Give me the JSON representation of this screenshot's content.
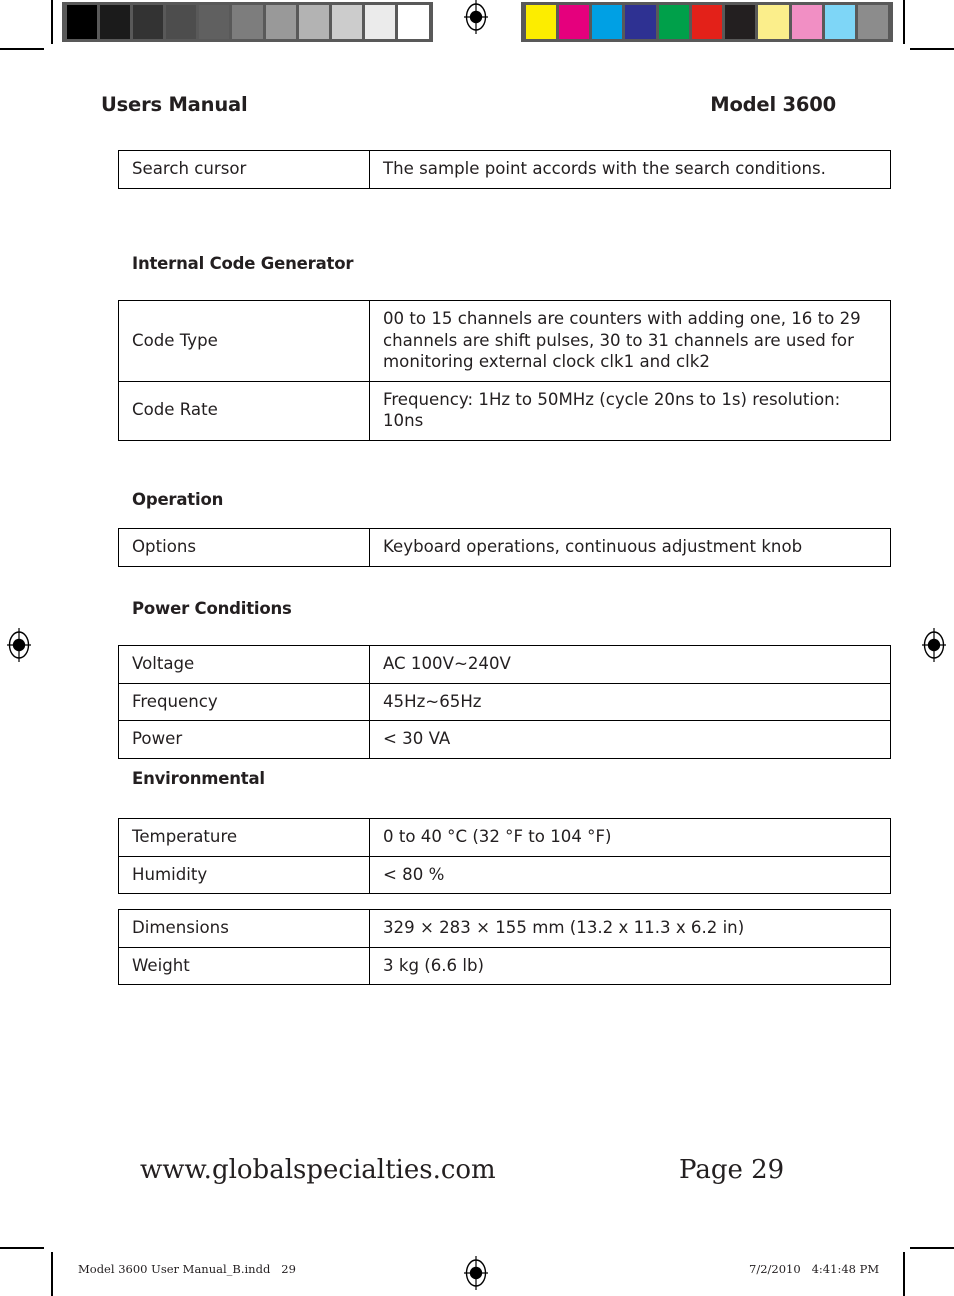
{
  "document": {
    "running_head_left": "Users Manual",
    "running_head_right": "Model 3600",
    "footer_url": "www.globalspecialties.com",
    "footer_page": "Page 29",
    "imprint_file": "Model 3600 User Manual_B.indd   29",
    "imprint_datetime": "7/2/2010   4:41:48 PM"
  },
  "calibration": {
    "gray_bar": {
      "name": "grayscale-calibration-bar",
      "swatches": [
        "#000000",
        "#1b1b1b",
        "#333333",
        "#4d4d4d",
        "#606060",
        "#7d7d7d",
        "#999999",
        "#b3b3b3",
        "#cccccc",
        "#ebebeb",
        "#ffffff"
      ]
    },
    "color_bar": {
      "name": "color-calibration-bar",
      "swatches": [
        "#fced00",
        "#e5007d",
        "#00a0e4",
        "#2e3192",
        "#00a04a",
        "#e32119",
        "#231f20",
        "#fbee8b",
        "#f18fc4",
        "#7ed6f7",
        "#8c8c8c"
      ]
    }
  },
  "tables": [
    {
      "id": "search-cursor-table",
      "heading": null,
      "rows": [
        {
          "key": "Search cursor",
          "value": "The sample point accords with the search conditions."
        }
      ]
    },
    {
      "id": "internal-code-generator-table",
      "heading": "Internal Code Generator",
      "rows": [
        {
          "key": "Code Type",
          "value": "00 to 15 channels are counters with adding one, 16 to 29 channels are shift pulses, 30 to 31 channels are used for monitoring external clock clk1 and clk2"
        },
        {
          "key": "Code Rate",
          "value": "Frequency: 1Hz to 50MHz (cycle 20ns to 1s) resolution: 10ns"
        }
      ]
    },
    {
      "id": "operation-table",
      "heading": "Operation",
      "rows": [
        {
          "key": "Options",
          "value": "Keyboard operations, continuous adjustment knob"
        }
      ]
    },
    {
      "id": "power-conditions-table",
      "heading": "Power Conditions",
      "rows": [
        {
          "key": "Voltage",
          "value": "AC 100V~240V"
        },
        {
          "key": "Frequency",
          "value": "45Hz~65Hz"
        },
        {
          "key": "Power",
          "value": " < 30 VA"
        }
      ]
    },
    {
      "id": "environmental-table",
      "heading": "Environmental",
      "rows": [
        {
          "key": "Temperature",
          "value": " 0 to 40 °C (32 °F to 104 °F)"
        },
        {
          "key": "Humidity",
          "value": "< 80 %"
        }
      ]
    },
    {
      "id": "physical-table",
      "heading": null,
      "rows": [
        {
          "key": "Dimensions",
          "value": "329 × 283 × 155 mm (13.2 x 11.3 x 6.2 in)"
        },
        {
          "key": "Weight",
          "value": "3 kg  (6.6 lb)"
        }
      ]
    }
  ]
}
